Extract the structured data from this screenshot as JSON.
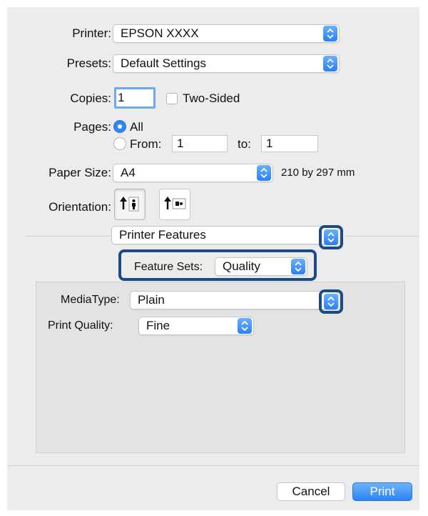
{
  "printer": {
    "label": "Printer:",
    "value": "EPSON XXXX"
  },
  "presets": {
    "label": "Presets:",
    "value": "Default Settings"
  },
  "copies": {
    "label": "Copies:",
    "value": "1",
    "two_sided_label": "Two-Sided",
    "two_sided_checked": false
  },
  "pages": {
    "label": "Pages:",
    "all_label": "All",
    "from_label": "From:",
    "from_value": "1",
    "to_label": "to:",
    "to_value": "1",
    "selected": "All"
  },
  "paper_size": {
    "label": "Paper Size:",
    "value": "A4",
    "dimensions": "210 by 297 mm"
  },
  "orientation": {
    "label": "Orientation:",
    "options": [
      "portrait-icon",
      "landscape-icon"
    ],
    "selected": "portrait"
  },
  "section_popup": {
    "value": "Printer Features"
  },
  "feature_sets": {
    "label": "Feature Sets:",
    "value": "Quality"
  },
  "media_type": {
    "label": "MediaType:",
    "value": "Plain"
  },
  "print_quality": {
    "label": "Print Quality:",
    "value": "Fine"
  },
  "buttons": {
    "cancel": "Cancel",
    "print": "Print"
  },
  "colors": {
    "accent": "#2f86f5",
    "highlight_border": "#1b4a84",
    "dialog_bg": "#ececec"
  }
}
